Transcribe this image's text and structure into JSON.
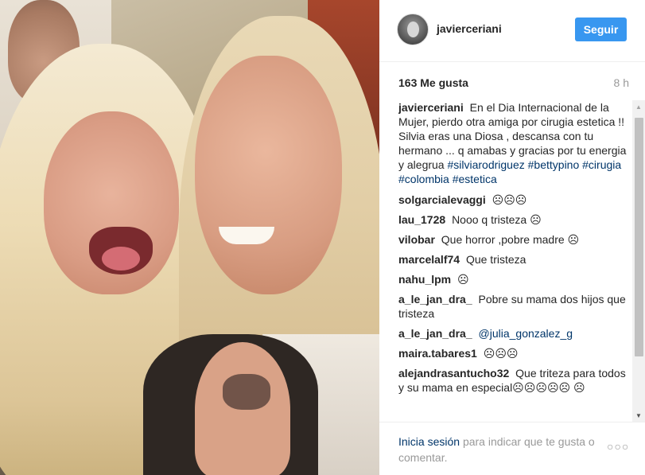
{
  "post": {
    "username": "javierceriani",
    "follow_label": "Seguir"
  },
  "stats": {
    "likes": "163 Me gusta",
    "time": "8 h"
  },
  "caption": {
    "user": "javierceriani",
    "text": "En el Dia Internacional de la Mujer, pierdo otra amiga por cirugia estetica !! Silvia eras una Diosa , descansa con tu hermano ... q amabas y gracias por tu energia y alegrua",
    "hashtags": "#silviarodriguez #bettypino #cirugia #colombia #estetica"
  },
  "comments": [
    {
      "user": "solgarcialevaggi",
      "text": "☹☹☹"
    },
    {
      "user": "lau_1728",
      "text": "Nooo q tristeza ☹"
    },
    {
      "user": "vilobar",
      "text": "Que horror ,pobre madre ☹"
    },
    {
      "user": "marcelalf74",
      "text": "Que tristeza"
    },
    {
      "user": "nahu_lpm",
      "text": "☹"
    },
    {
      "user": "a_le_jan_dra_",
      "text": "Pobre su mama dos hijos que tristeza"
    },
    {
      "user": "a_le_jan_dra_",
      "text": "@julia_gonzalez_g"
    },
    {
      "user": "maira.tabares1",
      "text": "☹☹☹"
    },
    {
      "user": "alejandrasantucho32",
      "text": "Que triteza para todos y su mama en especial☹☹☹☹☹ ☹"
    }
  ],
  "footer": {
    "login_label": "Inicia sesión",
    "rest_text": "para indicar que te gusta o comentar."
  },
  "icons": {
    "more": "more-options-icon"
  },
  "colors": {
    "accent": "#3897f0",
    "link": "#003569",
    "muted": "#999999"
  }
}
